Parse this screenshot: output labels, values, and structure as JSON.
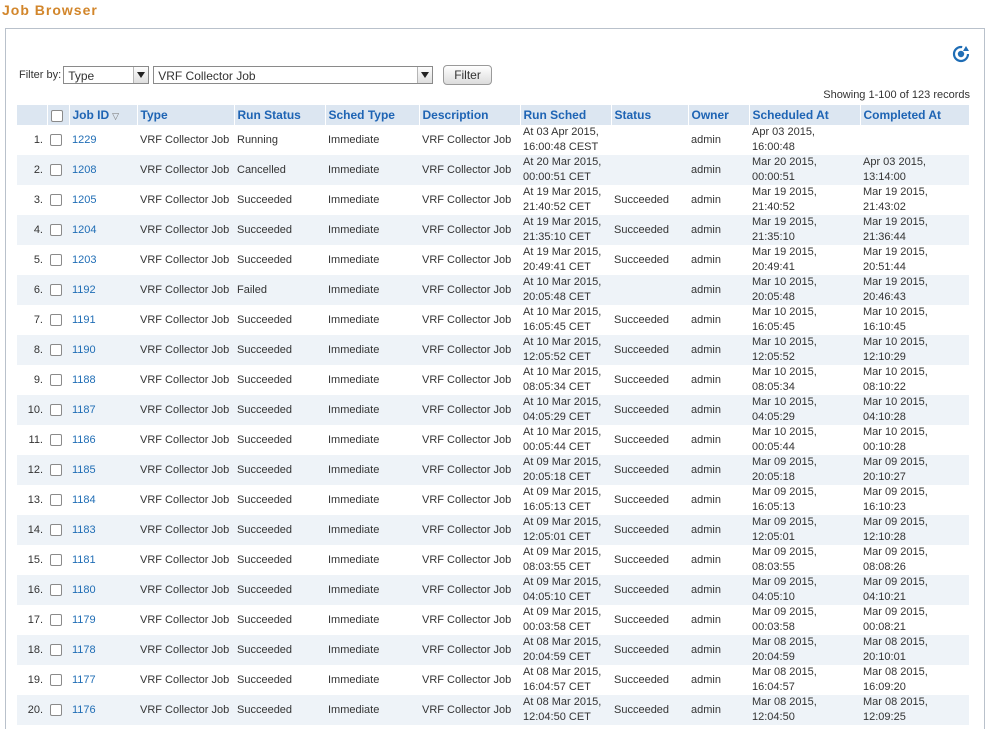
{
  "page": {
    "title": "Job Browser"
  },
  "filter": {
    "label": "Filter by:",
    "field": "Type",
    "value": "VRF Collector Job",
    "button": "Filter"
  },
  "summary": "Showing 1-100 of 123 records",
  "columns": {
    "job_id": "Job ID",
    "type": "Type",
    "run_status": "Run Status",
    "sched_type": "Sched Type",
    "description": "Description",
    "run_sched": "Run Sched",
    "status": "Status",
    "owner": "Owner",
    "scheduled_at": "Scheduled At",
    "completed_at": "Completed At"
  },
  "rows": [
    {
      "n": "1.",
      "id": "1229",
      "type": "VRF Collector Job",
      "run": "Running",
      "sched": "Immediate",
      "desc": "VRF Collector Job",
      "rs1": "At 03 Apr 2015,",
      "rs2": "16:00:48 CEST",
      "status": "",
      "owner": "admin",
      "sa1": "Apr 03 2015,",
      "sa2": "16:00:48",
      "ca1": "",
      "ca2": ""
    },
    {
      "n": "2.",
      "id": "1208",
      "type": "VRF Collector Job",
      "run": "Cancelled",
      "sched": "Immediate",
      "desc": "VRF Collector Job",
      "rs1": "At 20 Mar 2015,",
      "rs2": "00:00:51 CET",
      "status": "",
      "owner": "admin",
      "sa1": "Mar 20 2015,",
      "sa2": "00:00:51",
      "ca1": "Apr 03 2015,",
      "ca2": "13:14:00"
    },
    {
      "n": "3.",
      "id": "1205",
      "type": "VRF Collector Job",
      "run": "Succeeded",
      "sched": "Immediate",
      "desc": "VRF Collector Job",
      "rs1": "At 19 Mar 2015,",
      "rs2": "21:40:52 CET",
      "status": "Succeeded",
      "owner": "admin",
      "sa1": "Mar 19 2015,",
      "sa2": "21:40:52",
      "ca1": "Mar 19 2015,",
      "ca2": "21:43:02"
    },
    {
      "n": "4.",
      "id": "1204",
      "type": "VRF Collector Job",
      "run": "Succeeded",
      "sched": "Immediate",
      "desc": "VRF Collector Job",
      "rs1": "At 19 Mar 2015,",
      "rs2": "21:35:10 CET",
      "status": "Succeeded",
      "owner": "admin",
      "sa1": "Mar 19 2015,",
      "sa2": "21:35:10",
      "ca1": "Mar 19 2015,",
      "ca2": "21:36:44"
    },
    {
      "n": "5.",
      "id": "1203",
      "type": "VRF Collector Job",
      "run": "Succeeded",
      "sched": "Immediate",
      "desc": "VRF Collector Job",
      "rs1": "At 19 Mar 2015,",
      "rs2": "20:49:41 CET",
      "status": "Succeeded",
      "owner": "admin",
      "sa1": "Mar 19 2015,",
      "sa2": "20:49:41",
      "ca1": "Mar 19 2015,",
      "ca2": "20:51:44"
    },
    {
      "n": "6.",
      "id": "1192",
      "type": "VRF Collector Job",
      "run": "Failed",
      "sched": "Immediate",
      "desc": "VRF Collector Job",
      "rs1": "At 10 Mar 2015,",
      "rs2": "20:05:48 CET",
      "status": "",
      "owner": "admin",
      "sa1": "Mar 10 2015,",
      "sa2": "20:05:48",
      "ca1": "Mar 19 2015,",
      "ca2": "20:46:43"
    },
    {
      "n": "7.",
      "id": "1191",
      "type": "VRF Collector Job",
      "run": "Succeeded",
      "sched": "Immediate",
      "desc": "VRF Collector Job",
      "rs1": "At 10 Mar 2015,",
      "rs2": "16:05:45 CET",
      "status": "Succeeded",
      "owner": "admin",
      "sa1": "Mar 10 2015,",
      "sa2": "16:05:45",
      "ca1": "Mar 10 2015,",
      "ca2": "16:10:45"
    },
    {
      "n": "8.",
      "id": "1190",
      "type": "VRF Collector Job",
      "run": "Succeeded",
      "sched": "Immediate",
      "desc": "VRF Collector Job",
      "rs1": "At 10 Mar 2015,",
      "rs2": "12:05:52 CET",
      "status": "Succeeded",
      "owner": "admin",
      "sa1": "Mar 10 2015,",
      "sa2": "12:05:52",
      "ca1": "Mar 10 2015,",
      "ca2": "12:10:29"
    },
    {
      "n": "9.",
      "id": "1188",
      "type": "VRF Collector Job",
      "run": "Succeeded",
      "sched": "Immediate",
      "desc": "VRF Collector Job",
      "rs1": "At 10 Mar 2015,",
      "rs2": "08:05:34 CET",
      "status": "Succeeded",
      "owner": "admin",
      "sa1": "Mar 10 2015,",
      "sa2": "08:05:34",
      "ca1": "Mar 10 2015,",
      "ca2": "08:10:22"
    },
    {
      "n": "10.",
      "id": "1187",
      "type": "VRF Collector Job",
      "run": "Succeeded",
      "sched": "Immediate",
      "desc": "VRF Collector Job",
      "rs1": "At 10 Mar 2015,",
      "rs2": "04:05:29 CET",
      "status": "Succeeded",
      "owner": "admin",
      "sa1": "Mar 10 2015,",
      "sa2": "04:05:29",
      "ca1": "Mar 10 2015,",
      "ca2": "04:10:28"
    },
    {
      "n": "11.",
      "id": "1186",
      "type": "VRF Collector Job",
      "run": "Succeeded",
      "sched": "Immediate",
      "desc": "VRF Collector Job",
      "rs1": "At 10 Mar 2015,",
      "rs2": "00:05:44 CET",
      "status": "Succeeded",
      "owner": "admin",
      "sa1": "Mar 10 2015,",
      "sa2": "00:05:44",
      "ca1": "Mar 10 2015,",
      "ca2": "00:10:28"
    },
    {
      "n": "12.",
      "id": "1185",
      "type": "VRF Collector Job",
      "run": "Succeeded",
      "sched": "Immediate",
      "desc": "VRF Collector Job",
      "rs1": "At 09 Mar 2015,",
      "rs2": "20:05:18 CET",
      "status": "Succeeded",
      "owner": "admin",
      "sa1": "Mar 09 2015,",
      "sa2": "20:05:18",
      "ca1": "Mar 09 2015,",
      "ca2": "20:10:27"
    },
    {
      "n": "13.",
      "id": "1184",
      "type": "VRF Collector Job",
      "run": "Succeeded",
      "sched": "Immediate",
      "desc": "VRF Collector Job",
      "rs1": "At 09 Mar 2015,",
      "rs2": "16:05:13 CET",
      "status": "Succeeded",
      "owner": "admin",
      "sa1": "Mar 09 2015,",
      "sa2": "16:05:13",
      "ca1": "Mar 09 2015,",
      "ca2": "16:10:23"
    },
    {
      "n": "14.",
      "id": "1183",
      "type": "VRF Collector Job",
      "run": "Succeeded",
      "sched": "Immediate",
      "desc": "VRF Collector Job",
      "rs1": "At 09 Mar 2015,",
      "rs2": "12:05:01 CET",
      "status": "Succeeded",
      "owner": "admin",
      "sa1": "Mar 09 2015,",
      "sa2": "12:05:01",
      "ca1": "Mar 09 2015,",
      "ca2": "12:10:28"
    },
    {
      "n": "15.",
      "id": "1181",
      "type": "VRF Collector Job",
      "run": "Succeeded",
      "sched": "Immediate",
      "desc": "VRF Collector Job",
      "rs1": "At 09 Mar 2015,",
      "rs2": "08:03:55 CET",
      "status": "Succeeded",
      "owner": "admin",
      "sa1": "Mar 09 2015,",
      "sa2": "08:03:55",
      "ca1": "Mar 09 2015,",
      "ca2": "08:08:26"
    },
    {
      "n": "16.",
      "id": "1180",
      "type": "VRF Collector Job",
      "run": "Succeeded",
      "sched": "Immediate",
      "desc": "VRF Collector Job",
      "rs1": "At 09 Mar 2015,",
      "rs2": "04:05:10 CET",
      "status": "Succeeded",
      "owner": "admin",
      "sa1": "Mar 09 2015,",
      "sa2": "04:05:10",
      "ca1": "Mar 09 2015,",
      "ca2": "04:10:21"
    },
    {
      "n": "17.",
      "id": "1179",
      "type": "VRF Collector Job",
      "run": "Succeeded",
      "sched": "Immediate",
      "desc": "VRF Collector Job",
      "rs1": "At 09 Mar 2015,",
      "rs2": "00:03:58 CET",
      "status": "Succeeded",
      "owner": "admin",
      "sa1": "Mar 09 2015,",
      "sa2": "00:03:58",
      "ca1": "Mar 09 2015,",
      "ca2": "00:08:21"
    },
    {
      "n": "18.",
      "id": "1178",
      "type": "VRF Collector Job",
      "run": "Succeeded",
      "sched": "Immediate",
      "desc": "VRF Collector Job",
      "rs1": "At 08 Mar 2015,",
      "rs2": "20:04:59 CET",
      "status": "Succeeded",
      "owner": "admin",
      "sa1": "Mar 08 2015,",
      "sa2": "20:04:59",
      "ca1": "Mar 08 2015,",
      "ca2": "20:10:01"
    },
    {
      "n": "19.",
      "id": "1177",
      "type": "VRF Collector Job",
      "run": "Succeeded",
      "sched": "Immediate",
      "desc": "VRF Collector Job",
      "rs1": "At 08 Mar 2015,",
      "rs2": "16:04:57 CET",
      "status": "Succeeded",
      "owner": "admin",
      "sa1": "Mar 08 2015,",
      "sa2": "16:04:57",
      "ca1": "Mar 08 2015,",
      "ca2": "16:09:20"
    },
    {
      "n": "20.",
      "id": "1176",
      "type": "VRF Collector Job",
      "run": "Succeeded",
      "sched": "Immediate",
      "desc": "VRF Collector Job",
      "rs1": "At 08 Mar 2015,",
      "rs2": "12:04:50 CET",
      "status": "Succeeded",
      "owner": "admin",
      "sa1": "Mar 08 2015,",
      "sa2": "12:04:50",
      "ca1": "Mar 08 2015,",
      "ca2": "12:09:25"
    }
  ]
}
